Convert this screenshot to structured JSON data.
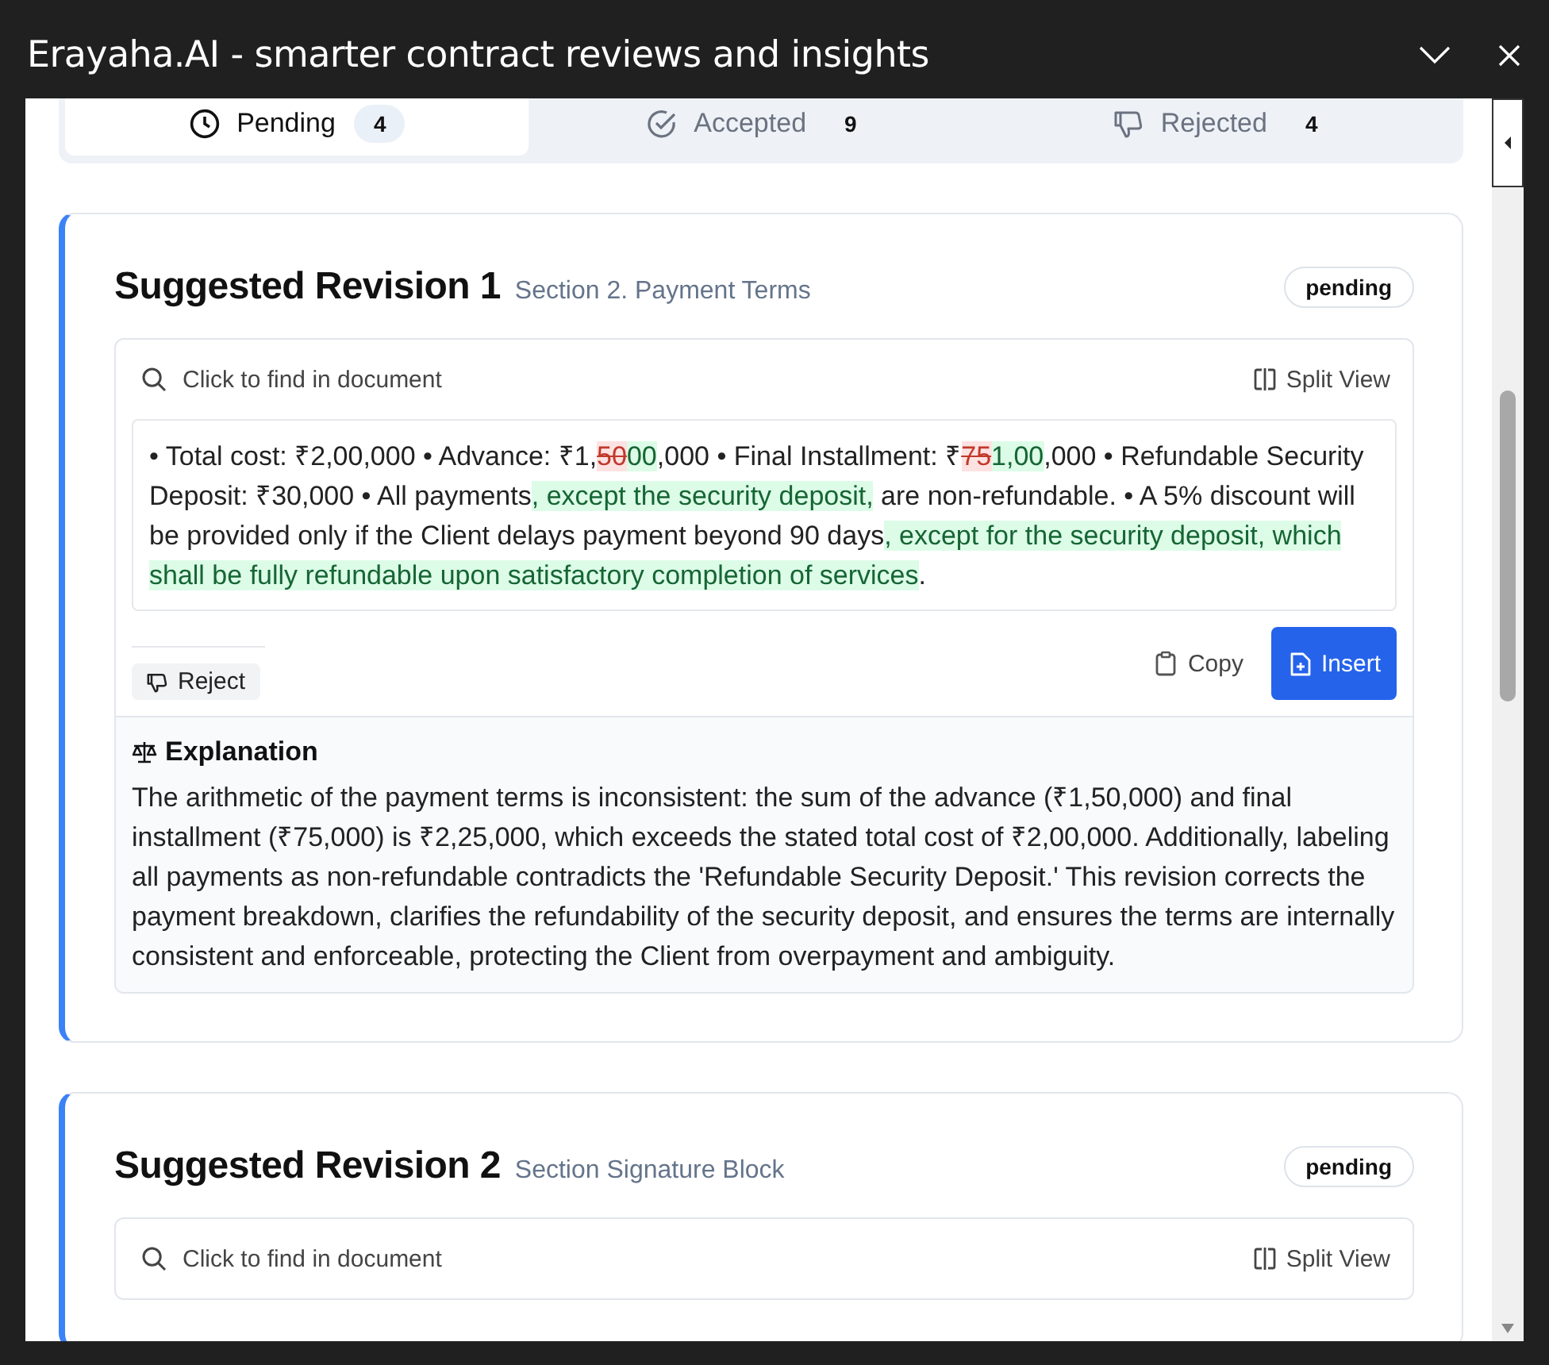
{
  "window": {
    "title": "Erayaha.AI - smarter contract reviews and insights"
  },
  "tabs": [
    {
      "kind": "pending",
      "label": "Pending",
      "count": "4",
      "selected": true
    },
    {
      "kind": "accepted",
      "label": "Accepted",
      "count": "9",
      "selected": false
    },
    {
      "kind": "rejected",
      "label": "Rejected",
      "count": "4",
      "selected": false
    }
  ],
  "revisions": [
    {
      "title": "Suggested Revision 1",
      "section": "Section 2. Payment Terms",
      "status": "pending",
      "find_label": "Click to find in document",
      "split_label": "Split View",
      "diff": [
        {
          "kind": "plain",
          "text": "• Total cost: ₹2,00,000 • Advance: ₹1,"
        },
        {
          "kind": "deleted",
          "text": "50"
        },
        {
          "kind": "inserted",
          "text": "00"
        },
        {
          "kind": "plain",
          "text": ",000 • Final Installment: ₹"
        },
        {
          "kind": "deleted",
          "text": "75"
        },
        {
          "kind": "inserted",
          "text": "1,00"
        },
        {
          "kind": "plain",
          "text": ",000 • Refundable Security Deposit: ₹30,000 • All payments"
        },
        {
          "kind": "inserted",
          "text": ", except the security deposit,"
        },
        {
          "kind": "plain",
          "text": " are non-refundable. • A 5% discount will be provided only if the Client delays payment beyond 90 days"
        },
        {
          "kind": "inserted",
          "text": ", except for the security deposit, which shall be fully refundable upon satisfactory completion of services"
        },
        {
          "kind": "plain",
          "text": "."
        }
      ],
      "reject_label": "Reject",
      "copy_label": "Copy",
      "insert_label": "Insert",
      "explanation_title": "Explanation",
      "explanation": "The arithmetic of the payment terms is inconsistent: the sum of the advance (₹1,50,000) and final installment (₹75,000) is ₹2,25,000, which exceeds the stated total cost of ₹2,00,000. Additionally, labeling all payments as non-refundable contradicts the 'Refundable Security Deposit.' This revision corrects the payment breakdown, clarifies the refundability of the security deposit, and ensures the terms are internally consistent and enforceable, protecting the Client from overpayment and ambiguity."
    },
    {
      "title": "Suggested Revision 2",
      "section": "Section Signature Block",
      "status": "pending",
      "find_label": "Click to find in document",
      "split_label": "Split View"
    }
  ]
}
